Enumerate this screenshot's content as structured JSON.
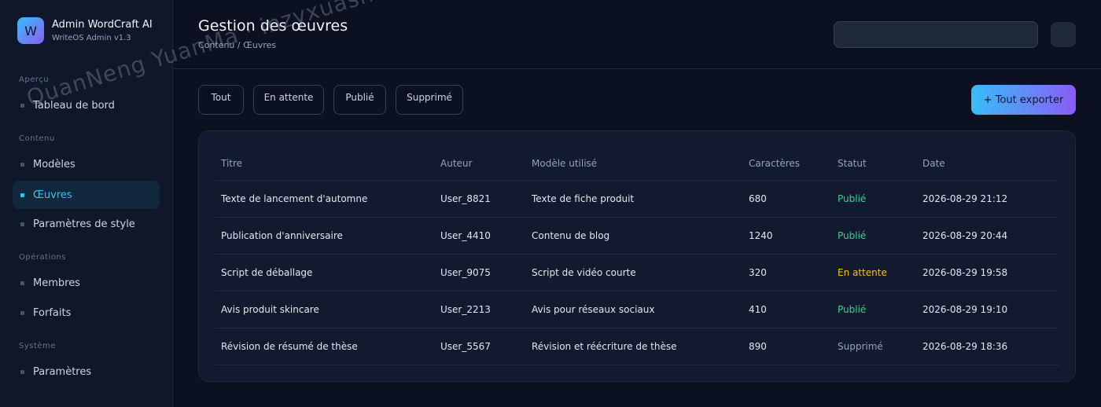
{
  "brand": {
    "logo_letter": "W",
    "name": "Admin WordCraft AI",
    "subtitle": "WriteOS Admin v1.3"
  },
  "sidebar": {
    "sections": [
      {
        "label": "Aperçu",
        "items": [
          {
            "label": "Tableau de bord",
            "active": false
          }
        ]
      },
      {
        "label": "Contenu",
        "items": [
          {
            "label": "Modèles",
            "active": false
          },
          {
            "label": "Œuvres",
            "active": true
          },
          {
            "label": "Paramètres de style",
            "active": false
          }
        ]
      },
      {
        "label": "Opérations",
        "items": [
          {
            "label": "Membres",
            "active": false
          },
          {
            "label": "Forfaits",
            "active": false
          }
        ]
      },
      {
        "label": "Système",
        "items": [
          {
            "label": "Paramètres",
            "active": false
          }
        ]
      }
    ]
  },
  "header": {
    "title": "Gestion des œuvres",
    "breadcrumb": "Contenu / Œuvres",
    "search_placeholder": ""
  },
  "filters": [
    "Tout",
    "En attente",
    "Publié",
    "Supprimé"
  ],
  "export_label": "+ Tout exporter",
  "table": {
    "columns": [
      "Titre",
      "Auteur",
      "Modèle utilisé",
      "Caractères",
      "Statut",
      "Date"
    ],
    "rows": [
      [
        "Texte de lancement d'automne",
        "User_8821",
        "Texte de fiche produit",
        "680",
        "Publié",
        "2026-08-29 21:12"
      ],
      [
        "Publication d'anniversaire",
        "User_4410",
        "Contenu de blog",
        "1240",
        "Publié",
        "2026-08-29 20:44"
      ],
      [
        "Script de déballage",
        "User_9075",
        "Script de vidéo courte",
        "320",
        "En attente",
        "2026-08-29 19:58"
      ],
      [
        "Avis produit skincare",
        "User_2213",
        "Avis pour réseaux sociaux",
        "410",
        "Publié",
        "2026-08-29 19:10"
      ],
      [
        "Révision de résumé de thèse",
        "User_5567",
        "Révision et réécriture de thèse",
        "890",
        "Supprimé",
        "2026-08-29 18:36"
      ]
    ]
  },
  "colors": {
    "accent": "#38bdf8",
    "published": "#34d399",
    "pending": "#fbbf24",
    "deleted": "#94a3b8"
  },
  "watermark": "QuanNeng YuanMa · inzyxuashop.com"
}
